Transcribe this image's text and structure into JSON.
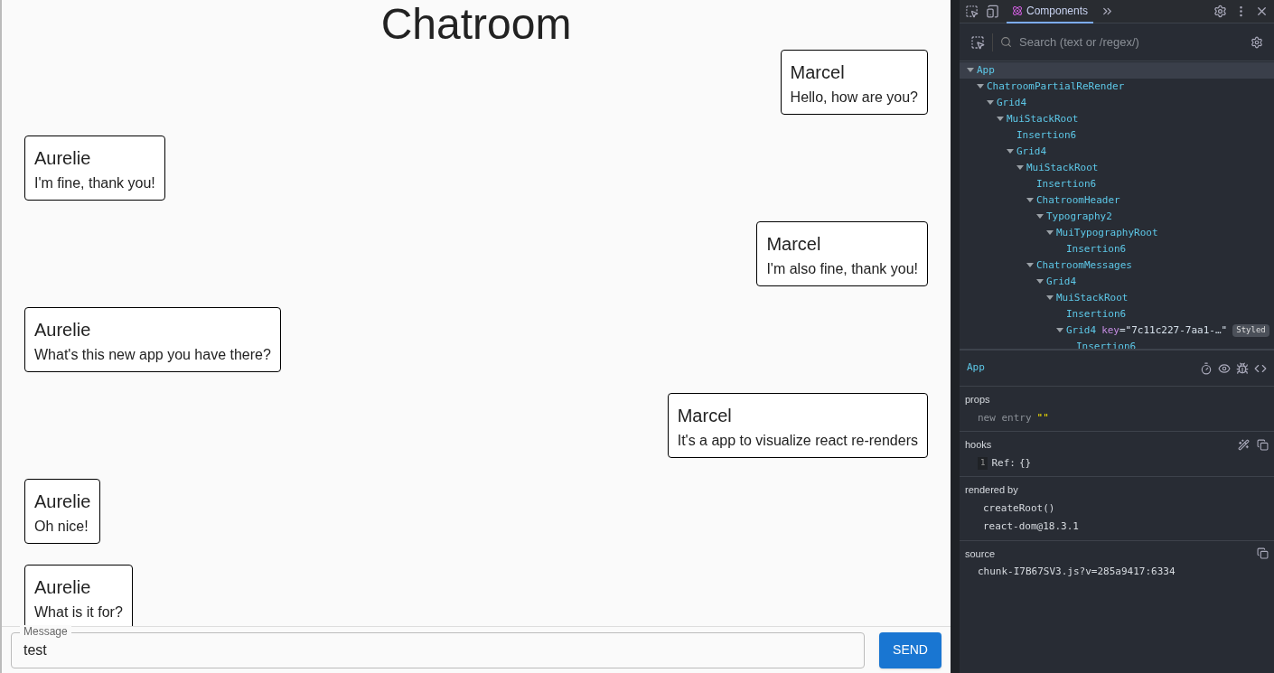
{
  "chat": {
    "title": "Chatroom",
    "messages": [
      {
        "kind": "sent",
        "author": "Marcel",
        "text": "Hello, how are you?"
      },
      {
        "kind": "received",
        "author": "Aurelie",
        "text": "I'm fine, thank you!"
      },
      {
        "kind": "sent",
        "author": "Marcel",
        "text": "I'm also fine, thank you!"
      },
      {
        "kind": "received",
        "author": "Aurelie",
        "text": "What's this new app you have there?"
      },
      {
        "kind": "sent",
        "author": "Marcel",
        "text": "It's a app to visualize react re-renders"
      },
      {
        "kind": "received",
        "author": "Aurelie",
        "text": "Oh nice!"
      },
      {
        "kind": "received",
        "author": "Aurelie",
        "text": "What is it for?"
      }
    ],
    "composer": {
      "label": "Message",
      "value": "test",
      "button": "SEND"
    }
  },
  "devtools": {
    "tabs": [
      {
        "label": "Components",
        "selected": true
      }
    ],
    "search": {
      "placeholder": "Search (text or /regex/)"
    },
    "tree": [
      {
        "name": "App",
        "selected": true,
        "expanded": true,
        "children": [
          {
            "name": "ChatroomPartialReRender",
            "selected": false,
            "expanded": true,
            "children": [
              {
                "name": "Grid4",
                "selected": false,
                "expanded": true,
                "children": [
                  {
                    "name": "MuiStackRoot",
                    "selected": false,
                    "expanded": true,
                    "children": [
                      {
                        "name": "Insertion6",
                        "selected": false
                      },
                      {
                        "name": "Grid4",
                        "selected": false,
                        "expanded": true,
                        "children": [
                          {
                            "name": "MuiStackRoot",
                            "selected": false,
                            "expanded": true,
                            "children": [
                              {
                                "name": "Insertion6",
                                "selected": false
                              },
                              {
                                "name": "ChatroomHeader",
                                "selected": false,
                                "expanded": true,
                                "children": [
                                  {
                                    "name": "Typography2",
                                    "selected": false,
                                    "expanded": true,
                                    "children": [
                                      {
                                        "name": "MuiTypographyRoot",
                                        "selected": false,
                                        "expanded": true,
                                        "children": [
                                          {
                                            "name": "Insertion6",
                                            "selected": false
                                          }
                                        ]
                                      }
                                    ]
                                  }
                                ]
                              },
                              {
                                "name": "ChatroomMessages",
                                "selected": false,
                                "expanded": true,
                                "children": [
                                  {
                                    "name": "Grid4",
                                    "selected": false,
                                    "expanded": true,
                                    "children": [
                                      {
                                        "name": "MuiStackRoot",
                                        "selected": false,
                                        "expanded": true,
                                        "children": [
                                          {
                                            "name": "Insertion6",
                                            "selected": false
                                          },
                                          {
                                            "name": "Grid4",
                                            "selected": false,
                                            "expanded": true,
                                            "attr_name": "key",
                                            "attr_value": "=\"7c11c227-7aa1-…\"",
                                            "badge": "Styled",
                                            "children": [
                                              {
                                                "name": "Insertion6",
                                                "selected": false
                                              }
                                            ]
                                          }
                                        ]
                                      }
                                    ]
                                  }
                                ]
                              }
                            ]
                          }
                        ]
                      }
                    ]
                  }
                ]
              }
            ]
          }
        ]
      }
    ],
    "details": {
      "component": "App",
      "props": {
        "heading": "props",
        "key": "new entry",
        "value": "\"\""
      },
      "hooks": {
        "heading": "hooks",
        "index": "1",
        "name": "Ref:",
        "value": "{}"
      },
      "rendered_by": {
        "heading": "rendered by",
        "items": [
          "createRoot()",
          "react-dom@18.3.1"
        ]
      },
      "source": {
        "heading": "source",
        "value": "chunk-I7B67SV3.js?v=285a9417:6334"
      }
    }
  }
}
